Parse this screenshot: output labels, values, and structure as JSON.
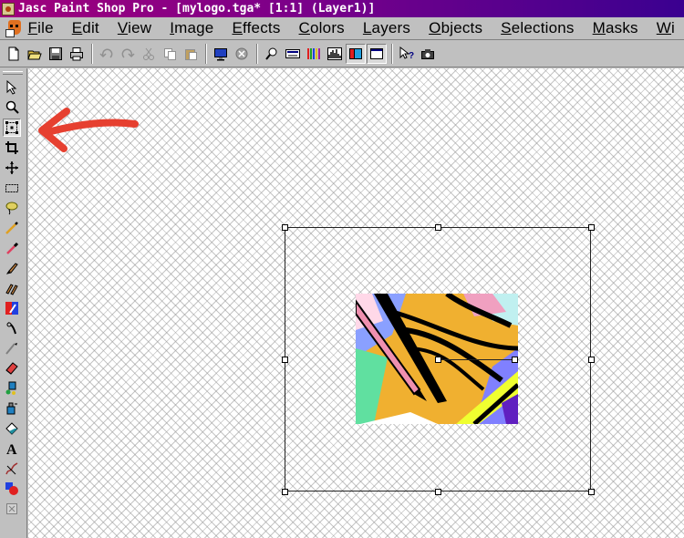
{
  "window": {
    "title": "Jasc Paint Shop Pro - [mylogo.tga* [1:1] (Layer1)]"
  },
  "menubar": {
    "items": [
      {
        "label": "File",
        "u": "F",
        "rest": "ile"
      },
      {
        "label": "Edit",
        "u": "E",
        "rest": "dit"
      },
      {
        "label": "View",
        "u": "V",
        "rest": "iew"
      },
      {
        "label": "Image",
        "u": "I",
        "rest": "mage"
      },
      {
        "label": "Effects",
        "u": "E",
        "rest": "ffects"
      },
      {
        "label": "Colors",
        "u": "C",
        "rest": "olors"
      },
      {
        "label": "Layers",
        "u": "L",
        "rest": "ayers"
      },
      {
        "label": "Objects",
        "u": "O",
        "rest": "bjects"
      },
      {
        "label": "Selections",
        "u": "S",
        "rest": "elections"
      },
      {
        "label": "Masks",
        "u": "M",
        "rest": "asks"
      },
      {
        "label": "Wi",
        "u": "W",
        "rest": "i"
      }
    ]
  },
  "toolbar": {
    "buttons": [
      "new-icon",
      "open-icon",
      "save-icon",
      "print-icon",
      "undo-icon",
      "redo-icon",
      "cut-icon",
      "copy-icon",
      "paste-icon",
      "full-screen-preview-icon",
      "normal-viewing-icon",
      "overview-icon",
      "tool-options-icon",
      "color-palette-icon",
      "histogram-icon",
      "layer-palette-icon",
      "tool-palette-icon",
      "context-help-icon",
      "acquire-icon"
    ]
  },
  "palette": {
    "tools": [
      "arrow-tool-icon",
      "zoom-tool-icon",
      "deformation-tool-icon",
      "crop-tool-icon",
      "mover-tool-icon",
      "selection-tool-icon",
      "freehand-tool-icon",
      "magic-wand-tool-icon",
      "dropper-tool-icon",
      "paint-brush-tool-icon",
      "clone-brush-tool-icon",
      "color-replacer-tool-icon",
      "retouch-tool-icon",
      "scratch-remover-tool-icon",
      "eraser-tool-icon",
      "picture-tube-tool-icon",
      "airbrush-tool-icon",
      "flood-fill-tool-icon",
      "text-tool-icon",
      "draw-tool-icon",
      "preset-shapes-tool-icon",
      "object-selector-tool-icon"
    ],
    "active_tool": "deformation-tool-icon"
  },
  "colors": {
    "title_start": "#a0007c",
    "title_end": "#3a0090",
    "annotation_arrow": "#e64030",
    "ui_face": "#c0c0c0"
  }
}
